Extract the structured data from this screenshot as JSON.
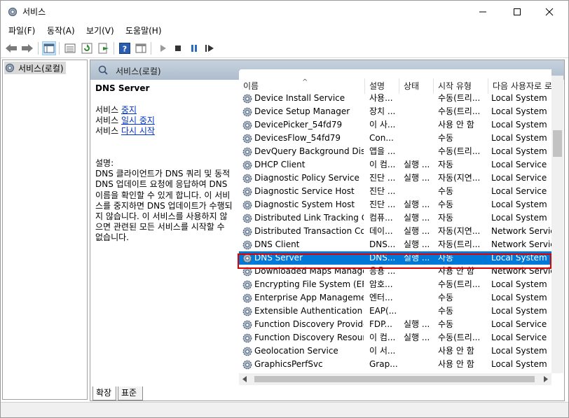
{
  "window": {
    "title": "서비스"
  },
  "menu": [
    "파일(F)",
    "동작(A)",
    "보기(V)",
    "도움말(H)"
  ],
  "tree": {
    "item": "서비스(로컬)"
  },
  "pane": {
    "header": "서비스(로컬)"
  },
  "details": {
    "service_name": "DNS Server",
    "actions": [
      {
        "prefix": "서비스 ",
        "link": "중지"
      },
      {
        "prefix": "서비스 ",
        "link": "일시 중지"
      },
      {
        "prefix": "서비스 ",
        "link": "다시 시작"
      }
    ],
    "desc_label": "설명:",
    "desc_text": "DNS 클라이언트가 DNS 쿼리 및 동적 DNS 업데이트 요청에 응답하여 DNS 이름을 확인할 수 있게 합니다. 이 서비스를 중지하면 DNS 업데이트가 수행되지 않습니다. 이 서비스를 사용하지 않으면 관련된 모든 서비스를 시작할 수 없습니다."
  },
  "columns": {
    "name": "이름",
    "desc": "설명",
    "state": "상태",
    "start": "시작 유형",
    "logon": "다음 사용자로 로"
  },
  "services": [
    {
      "name": "Device Install Service",
      "desc": "사용...",
      "state": "",
      "start": "수동(트리...",
      "logon": "Local System"
    },
    {
      "name": "Device Setup Manager",
      "desc": "장치 ...",
      "state": "",
      "start": "수동(트리...",
      "logon": "Local System"
    },
    {
      "name": "DevicePicker_54fd79",
      "desc": "이 사...",
      "state": "",
      "start": "사용 안 함",
      "logon": "Local System"
    },
    {
      "name": "DevicesFlow_54fd79",
      "desc": "Con...",
      "state": "",
      "start": "수동",
      "logon": "Local System"
    },
    {
      "name": "DevQuery Background Dis...",
      "desc": "앱을 ...",
      "state": "",
      "start": "수동(트리...",
      "logon": "Local System"
    },
    {
      "name": "DHCP Client",
      "desc": "이 컴...",
      "state": "실행 ...",
      "start": "자동",
      "logon": "Local Service"
    },
    {
      "name": "Diagnostic Policy Service",
      "desc": "진단 ...",
      "state": "실행 ...",
      "start": "자동(지연...",
      "logon": "Local Service"
    },
    {
      "name": "Diagnostic Service Host",
      "desc": "진단 ...",
      "state": "",
      "start": "수동",
      "logon": "Local Service"
    },
    {
      "name": "Diagnostic System Host",
      "desc": "진단 ...",
      "state": "실행 ...",
      "start": "수동",
      "logon": "Local System"
    },
    {
      "name": "Distributed Link Tracking C...",
      "desc": "컴퓨...",
      "state": "실행 ...",
      "start": "자동",
      "logon": "Local System"
    },
    {
      "name": "Distributed Transaction Co...",
      "desc": "데이...",
      "state": "실행 ...",
      "start": "자동(지연...",
      "logon": "Network Service"
    },
    {
      "name": "DNS Client",
      "desc": "DNS...",
      "state": "실행 ...",
      "start": "자동(트리...",
      "logon": "Network Service"
    },
    {
      "name": "DNS Server",
      "desc": "DNS...",
      "state": "실행 ...",
      "start": "자동",
      "logon": "Local System",
      "selected": true
    },
    {
      "name": "Downloaded Maps Manager",
      "desc": "응용 ...",
      "state": "",
      "start": "사용 안 함",
      "logon": "Network Service"
    },
    {
      "name": "Encrypting File System (EFS)",
      "desc": "암호...",
      "state": "",
      "start": "수동(트리...",
      "logon": "Local System"
    },
    {
      "name": "Enterprise App Manageme...",
      "desc": "엔터...",
      "state": "",
      "start": "수동",
      "logon": "Local System"
    },
    {
      "name": "Extensible Authentication P...",
      "desc": "EAP(...",
      "state": "",
      "start": "수동",
      "logon": "Local System"
    },
    {
      "name": "Function Discovery Provide...",
      "desc": "FDP...",
      "state": "실행 ...",
      "start": "수동",
      "logon": "Local Service"
    },
    {
      "name": "Function Discovery Resour...",
      "desc": "이 컴...",
      "state": "실행 ...",
      "start": "수동(트리...",
      "logon": "Local Service"
    },
    {
      "name": "Geolocation Service",
      "desc": "이 서...",
      "state": "",
      "start": "사용 안 함",
      "logon": "Local System"
    },
    {
      "name": "GraphicsPerfSvc",
      "desc": "Grap...",
      "state": "",
      "start": "사용 안 함",
      "logon": "Local System"
    }
  ],
  "tabs": {
    "extended": "확장",
    "standard": "표준"
  },
  "colors": {
    "selection": "#0078d7",
    "highlight_border": "#e00000",
    "link": "#0033cc"
  }
}
